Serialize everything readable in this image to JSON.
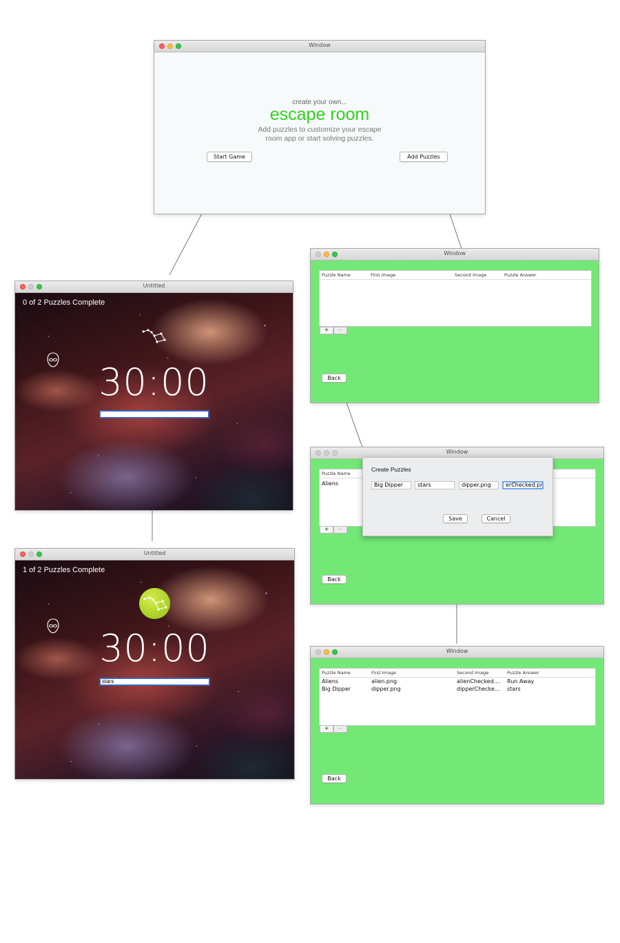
{
  "home_window": {
    "title": "Window",
    "tagline": "create your own...",
    "app_name": "escape room",
    "description_line1": "Add puzzles to customize your escape",
    "description_line2": "room app or start solving puzzles.",
    "start_button": "Start Game",
    "add_button": "Add Puzzles",
    "accent_color": "#32d11e"
  },
  "game_window_1": {
    "title": "Untitled",
    "progress": "0 of 2 Puzzles Complete",
    "timer": "30:00",
    "answer_value": ""
  },
  "game_window_2": {
    "title": "Untitled",
    "progress": "1 of 2 Puzzles Complete",
    "timer": "30:00",
    "answer_value": "stars"
  },
  "puzzles_window_empty": {
    "title": "Window",
    "columns": [
      "Puzzle Name",
      "First Image",
      "Second Image",
      "Puzzle Answer"
    ],
    "add_label": "+",
    "remove_label": "−",
    "back_button": "Back"
  },
  "create_window": {
    "title": "Window",
    "column_visible": "Puzzle Name",
    "row_visible": "Aliens",
    "dialog_title": "Create Puzzles",
    "fields": [
      "Big Dipper",
      "stars",
      "dipper.png",
      "erChecked.png"
    ],
    "save_button": "Save",
    "cancel_button": "Cancel",
    "add_label": "+",
    "remove_label": "−",
    "back_button": "Back"
  },
  "puzzles_window_filled": {
    "title": "Window",
    "columns": [
      "Puzzle Name",
      "First Image",
      "Second Image",
      "Puzzle Answer"
    ],
    "rows": [
      [
        "Aliens",
        "alien.png",
        "alienChecked....",
        "Run Away"
      ],
      [
        "Big Dipper",
        "dipper.png",
        "dipperChecke...",
        "stars"
      ]
    ],
    "add_label": "+",
    "remove_label": "−",
    "back_button": "Back"
  },
  "colors": {
    "panel_green": "#73e876",
    "window_bg": "#f7fafa",
    "answer_border": "#3e63b5",
    "solved_badge": "#b9d92c"
  }
}
